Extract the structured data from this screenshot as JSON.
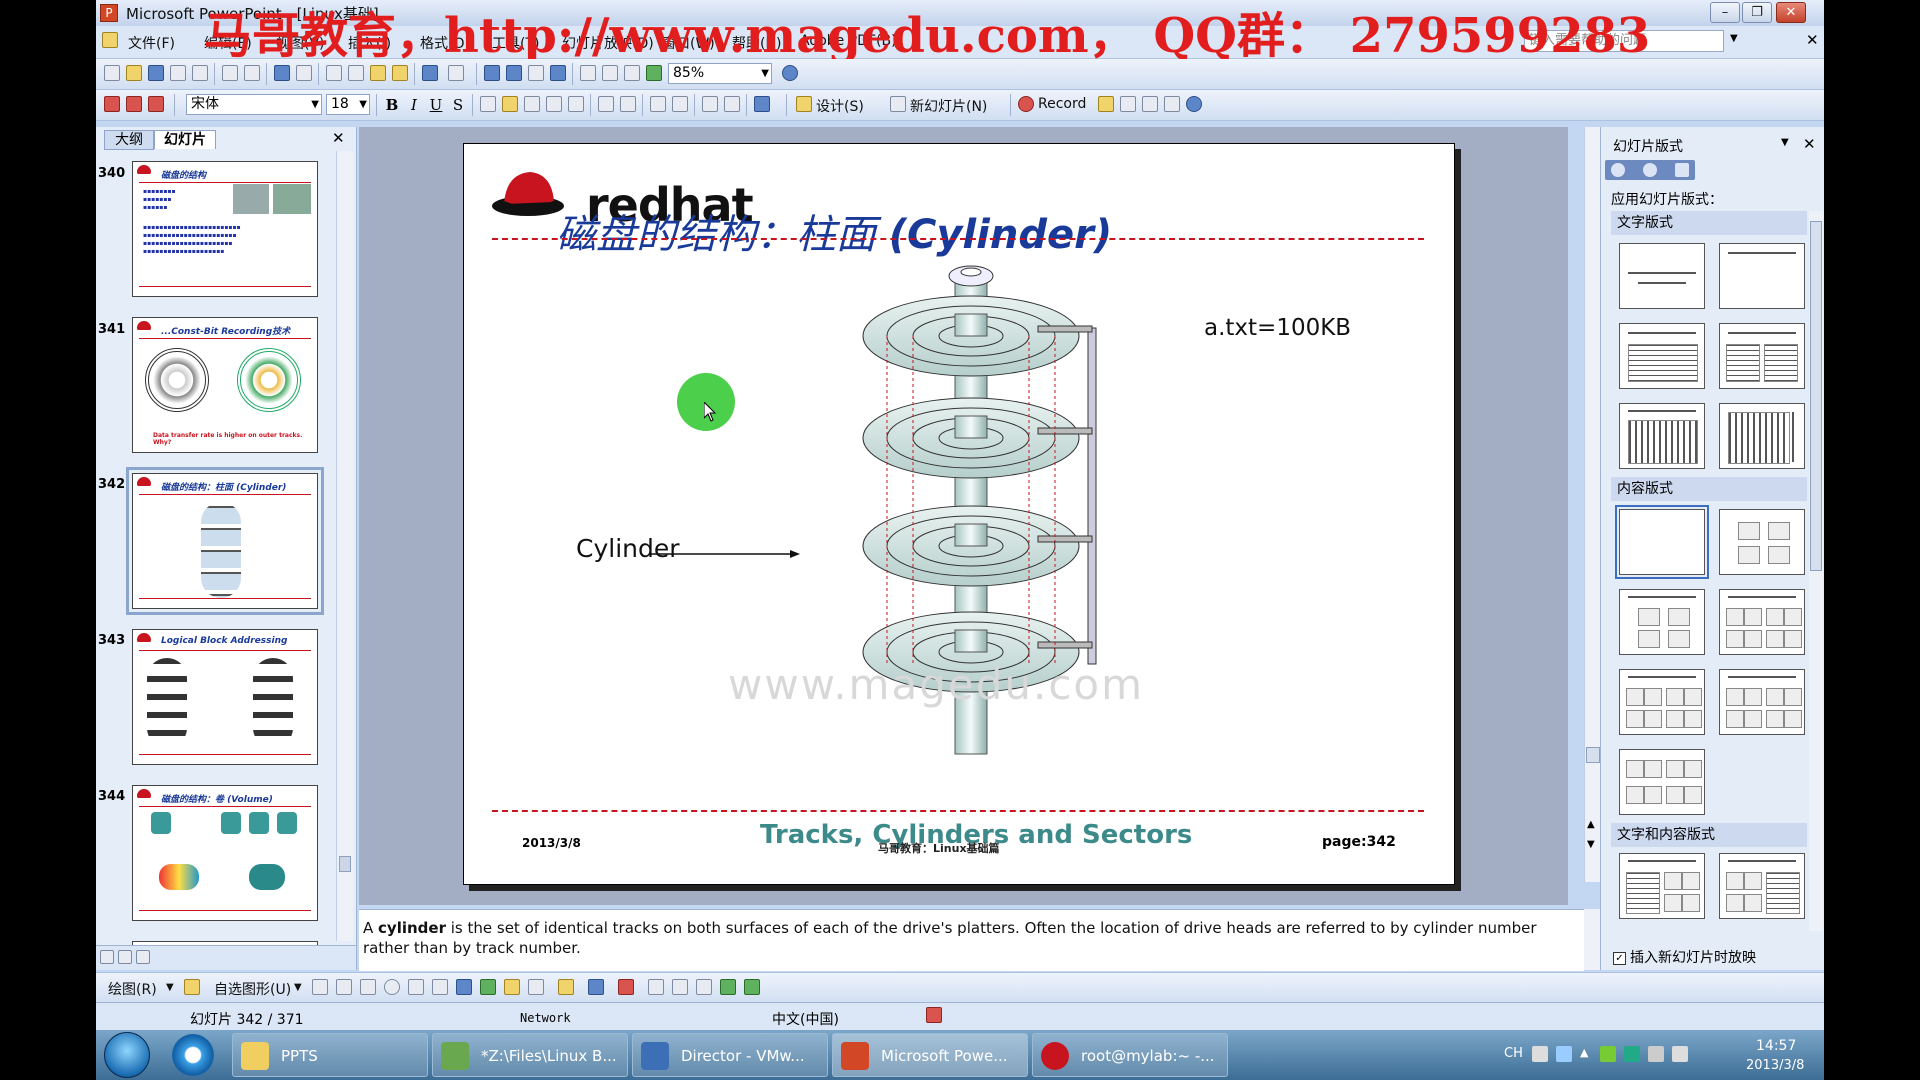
{
  "window": {
    "title": "Microsoft PowerPoint - [Linux基础]",
    "overlay_watermark": "马哥教育，http://www.magedu.com，  QQ群：  279599283"
  },
  "menu": {
    "items": [
      "文件(F)",
      "编辑(E)",
      "视图(V)",
      "插入(I)",
      "格式(O)",
      "工具(T)",
      "幻灯片放映(D)",
      "窗口(W)",
      "帮助(H)",
      "Adobe PDF(B)"
    ],
    "help_placeholder": "键入需要帮助的问题"
  },
  "toolbar_standard": {
    "zoom": "85%"
  },
  "toolbar_format": {
    "font_name": "宋体",
    "font_size": "18",
    "bold": "B",
    "italic": "I",
    "underline": "U",
    "shadow": "S",
    "design_label": "设计(S)",
    "new_slide_label": "新幻灯片(N)",
    "record_label": "Record"
  },
  "left_panel": {
    "tabs": [
      "大纲",
      "幻灯片"
    ],
    "thumbnails": [
      {
        "number": "340",
        "title": "磁盘的结构",
        "caption": ""
      },
      {
        "number": "341",
        "title": "...Const-Bit Recording技术",
        "caption": "Data transfer rate is higher on outer tracks. Why?"
      },
      {
        "number": "342",
        "title": "磁盘的结构：柱面 (Cylinder)",
        "caption": ""
      },
      {
        "number": "343",
        "title": "Logical Block Addressing",
        "caption": ""
      },
      {
        "number": "344",
        "title": "磁盘的结构：卷 (Volume)",
        "caption": ""
      },
      {
        "number": "345",
        "title": "",
        "caption": ""
      }
    ]
  },
  "slide": {
    "logo_text": "redhat",
    "title_cn": "磁盘的结构：柱面 ",
    "title_en": "(Cylinder)",
    "file_label": "a.txt=100KB",
    "cylinder_label": "Cylinder",
    "watermark": "www.magedu.com",
    "footer_title": "Tracks, Cylinders and Sectors",
    "footer_sub": "马哥教育：Linux基础篇",
    "date": "2013/3/8",
    "page_prefix": "page:",
    "page_number": "342"
  },
  "notes": {
    "text_before": "A ",
    "bold_word": "cylinder",
    "text_after": " is the set of identical tracks on both surfaces of each of the drive's platters. Often the location of drive heads are referred to by cylinder number rather than by track number."
  },
  "task_pane": {
    "title": "幻灯片版式",
    "apply_label": "应用幻灯片版式：",
    "sections": [
      "文字版式",
      "内容版式",
      "文字和内容版式"
    ],
    "insert_checkbox_label": "插入新幻灯片时放映",
    "insert_checkbox_checked": true
  },
  "drawing_toolbar": {
    "draw_label": "绘图(R)",
    "autoshape_label": "自选图形(U)"
  },
  "status_bar": {
    "slide_info": "幻灯片 342 / 371",
    "design": "Network",
    "language": "中文(中国)"
  },
  "taskbar": {
    "items": [
      "PPTS",
      "*Z:\\Files\\Linux B...",
      "Director - VMw...",
      "Microsoft Powe...",
      "root@mylab:~ -..."
    ],
    "lang": "CH",
    "time": "14:57",
    "date": "2013/3/8"
  }
}
